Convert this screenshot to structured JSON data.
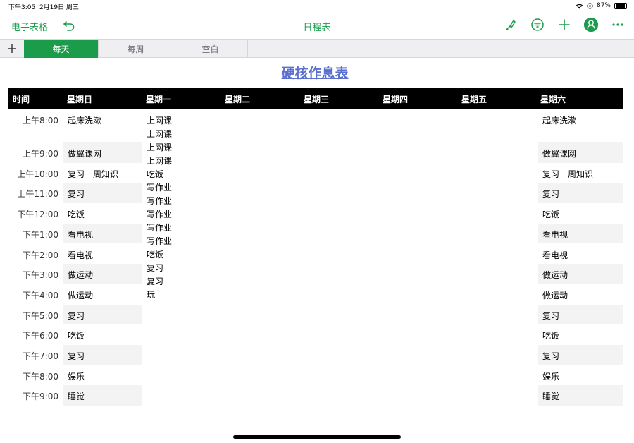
{
  "status": {
    "time": "下午3:05",
    "date": "2月19日 周三",
    "battery": "87%"
  },
  "toolbar": {
    "back_label": "电子表格",
    "doc_title": "日程表"
  },
  "tabs": [
    {
      "label": "每天",
      "active": true
    },
    {
      "label": "每周",
      "active": false
    },
    {
      "label": "空白",
      "active": false
    }
  ],
  "table": {
    "title": "硬核作息表",
    "headers": [
      "时间",
      "星期日",
      "星期一",
      "星期二",
      "星期三",
      "星期四",
      "星期五",
      "星期六"
    ],
    "rows": [
      {
        "time": "上午8:00",
        "sun": "起床洗漱",
        "sat": "起床洗漱"
      },
      {
        "time": "上午9:00",
        "sun": "做翼课网",
        "sat": "做翼课网"
      },
      {
        "time": "上午10:00",
        "sun": "复习一周知识",
        "sat": "复习一周知识"
      },
      {
        "time": "上午11:00",
        "sun": "复习",
        "sat": "复习"
      },
      {
        "time": "下午12:00",
        "sun": "吃饭",
        "sat": "吃饭"
      },
      {
        "time": "下午1:00",
        "sun": "看电视",
        "sat": "看电视"
      },
      {
        "time": "下午2:00",
        "sun": "看电视",
        "sat": "看电视"
      },
      {
        "time": "下午3:00",
        "sun": "做运动",
        "sat": "做运动"
      },
      {
        "time": "下午4:00",
        "sun": "做运动",
        "sat": "做运动"
      },
      {
        "time": "下午5:00",
        "sun": "复习",
        "sat": "复习"
      },
      {
        "time": "下午6:00",
        "sun": "吃饭",
        "sat": "吃饭"
      },
      {
        "time": "下午7:00",
        "sun": "复习",
        "sat": "复习"
      },
      {
        "time": "下午8:00",
        "sun": "娱乐",
        "sat": "娱乐"
      },
      {
        "time": "下午9:00",
        "sun": "睡觉",
        "sat": "睡觉"
      }
    ],
    "monday_items": [
      "上网课",
      "上网课",
      "上网课",
      "上网课",
      "吃饭",
      "写作业",
      "写作业",
      "写作业",
      "写作业",
      "写作业",
      "吃饭",
      "复习",
      "复习",
      "玩"
    ]
  },
  "colors": {
    "accent": "#1a9c4b",
    "title": "#5b6fd1",
    "header_bg": "#000000",
    "row_shade": "#f3f3f3"
  },
  "icons": [
    "undo-icon",
    "brush-icon",
    "filter-icon",
    "plus-icon",
    "collaborate-icon",
    "more-icon",
    "wifi-icon",
    "battery-icon"
  ]
}
